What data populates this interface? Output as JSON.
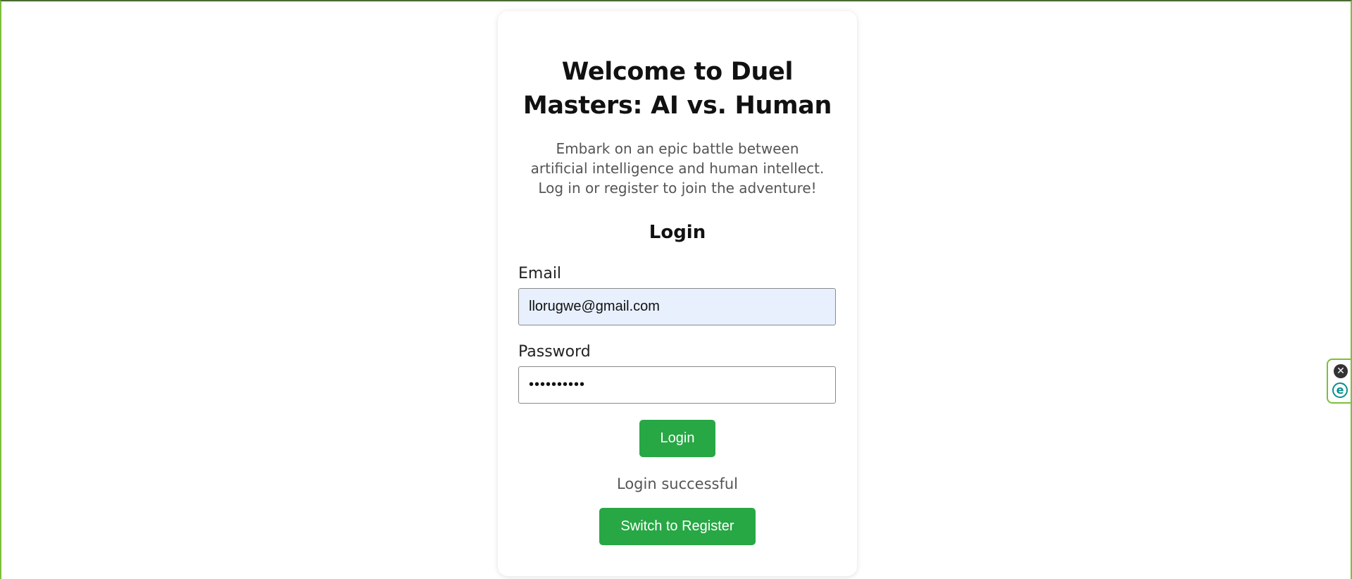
{
  "header": {
    "title": "Welcome to Duel Masters: AI vs. Human",
    "subtitle": "Embark on an epic battle between artificial intelligence and human intellect. Log in or register to join the adventure!"
  },
  "login_form": {
    "heading": "Login",
    "email_label": "Email",
    "email_value": "llorugwe@gmail.com",
    "password_label": "Password",
    "password_value": "••••••••••",
    "login_button": "Login",
    "status_message": "Login successful",
    "switch_button": "Switch to Register"
  },
  "extension_widget": {
    "close_glyph": "✕",
    "logo_glyph": "e",
    "close_icon": "close-icon",
    "logo_icon": "extension-logo-icon"
  },
  "colors": {
    "accent_green": "#28a745",
    "frame_border": "#7cbf3a",
    "autofill_background": "#e8f0fe"
  }
}
